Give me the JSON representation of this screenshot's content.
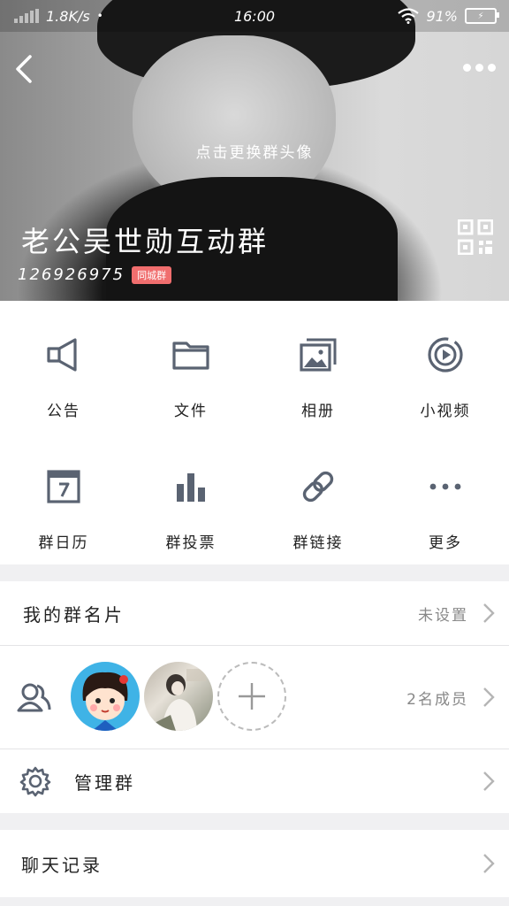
{
  "status_bar": {
    "net_speed": "1.8K/s",
    "time": "16:00",
    "battery_pct": "91%"
  },
  "header": {
    "change_avatar_hint": "点击更换群头像",
    "group_name": "老公吴世勋互动群",
    "group_id": "126926975",
    "badge": "同城群"
  },
  "functions": [
    {
      "label": "公告",
      "icon": "megaphone-icon"
    },
    {
      "label": "文件",
      "icon": "folder-icon"
    },
    {
      "label": "相册",
      "icon": "photo-album-icon"
    },
    {
      "label": "小视频",
      "icon": "video-icon"
    },
    {
      "label": "群日历",
      "icon": "calendar-icon"
    },
    {
      "label": "群投票",
      "icon": "bar-chart-icon"
    },
    {
      "label": "群链接",
      "icon": "link-icon"
    },
    {
      "label": "更多",
      "icon": "more-dots-icon"
    }
  ],
  "rows": {
    "my_card": {
      "title": "我的群名片",
      "value": "未设置"
    },
    "members": {
      "count": "2名成员"
    },
    "manage": {
      "title": "管理群"
    },
    "chat_history": {
      "title": "聊天记录"
    }
  },
  "colors": {
    "icon": "#5a6372",
    "badge": "#f06e6e"
  }
}
